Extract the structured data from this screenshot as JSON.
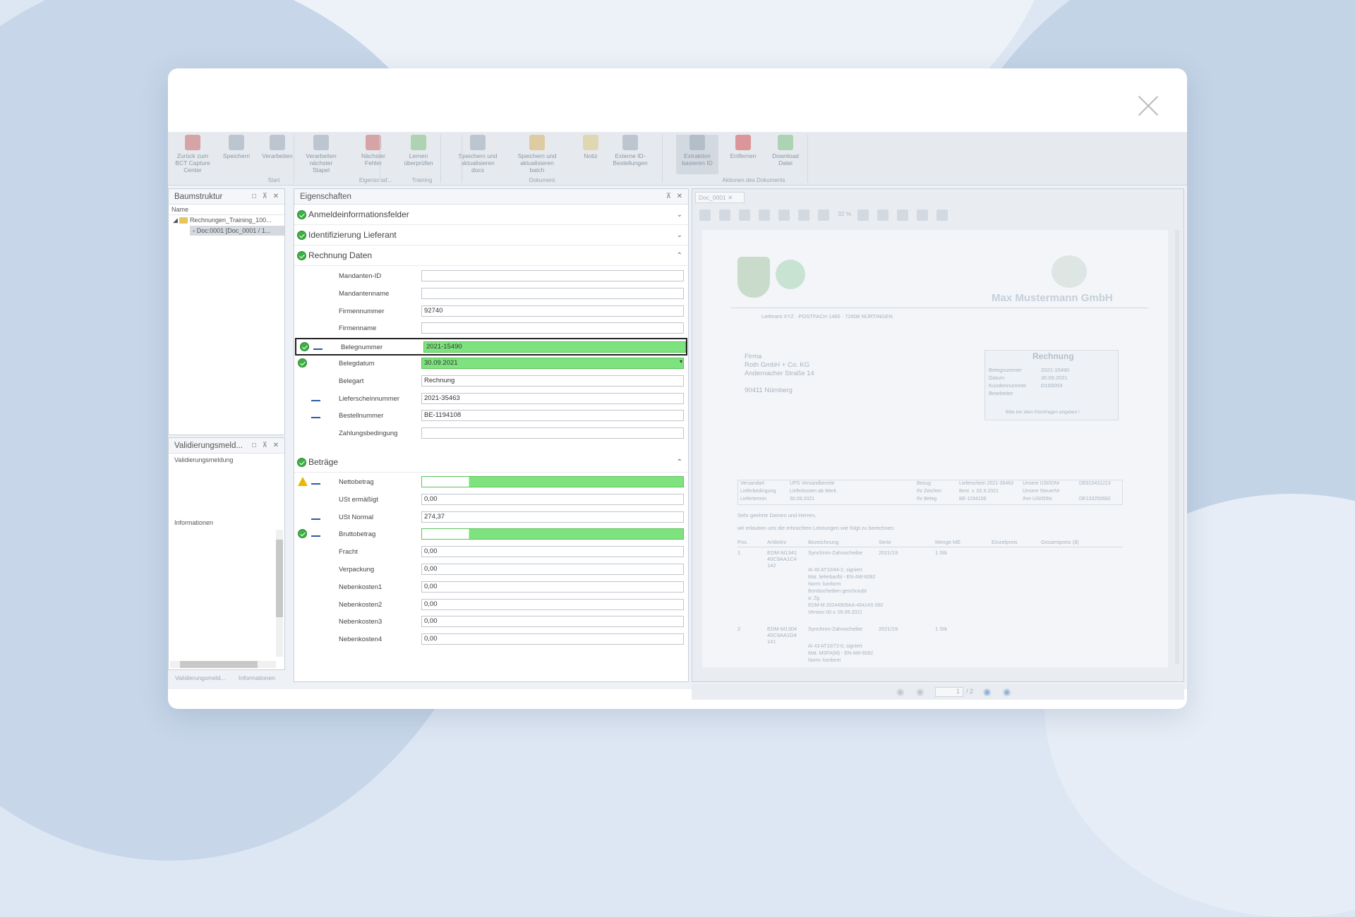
{
  "ribbon": {
    "buttons": [
      {
        "label": "Zurück zum BCT Capture Center",
        "icon": "back-icon",
        "color": "#c96a6a"
      },
      {
        "label": "Speichern",
        "icon": "save-icon",
        "color": "#9aa7b6"
      },
      {
        "label": "Verarbeiten",
        "icon": "process-icon",
        "color": "#9aa7b6"
      },
      {
        "label": "Verarbeiten nächster Stapel",
        "icon": "process-next-icon",
        "color": "#9aa7b6"
      },
      {
        "label": "Nächster Fehler",
        "icon": "next-error-icon",
        "color": "#c96a6a"
      },
      {
        "label": "Lernen überprüfen",
        "icon": "learn-icon",
        "color": "#7fbf7f"
      },
      {
        "label": "Speichern und aktualisieren docs",
        "icon": "save-update-docs-icon",
        "color": "#9aa7b6"
      },
      {
        "label": "Speichern und aktualisieren batch",
        "icon": "save-update-batch-icon",
        "color": "#d9b060"
      },
      {
        "label": "Notiz",
        "icon": "note-icon",
        "color": "#d9c480"
      },
      {
        "label": "Externe ID-Bestellungen",
        "icon": "external-id-icon",
        "color": "#9aa7b6"
      },
      {
        "label": "Extraktion basieren ID",
        "icon": "extraction-icon",
        "color": "#9aa7b6"
      },
      {
        "label": "Entfernen",
        "icon": "remove-icon",
        "color": "#d05050"
      },
      {
        "label": "Download Datei",
        "icon": "download-icon",
        "color": "#7fbf7f"
      }
    ],
    "groups": [
      "Start",
      "Eigenschaf...",
      "Training",
      "Dokument",
      "Aktionen des Dokuments"
    ]
  },
  "tree_panel": {
    "title": "Baumstruktur",
    "column": "Name",
    "items": [
      "Rechnungen_Training_100...",
      "Doc:0001 [Doc_0001 / 1..."
    ]
  },
  "validation_panel": {
    "title": "Validierungsmeld...",
    "header": "Validierungsmeldung",
    "info_header": "Informationen",
    "tabs": [
      "Validierungsmeld...",
      "Informationen"
    ]
  },
  "properties": {
    "title": "Eigenschaften",
    "sections": [
      "Anmeldeinformationsfelder",
      "Identifizierung Lieferant",
      "Rechnung Daten",
      "Beträge"
    ],
    "rechnung": [
      {
        "label": "Mandanten-ID",
        "value": ""
      },
      {
        "label": "Mandantenname",
        "value": ""
      },
      {
        "label": "Firmennummer",
        "value": "92740"
      },
      {
        "label": "Firmenname",
        "value": ""
      },
      {
        "label": "Belegnummer",
        "value": "2021-15490"
      },
      {
        "label": "Belegdatum",
        "value": "30.09.2021"
      },
      {
        "label": "Belegart",
        "value": "Rechnung"
      },
      {
        "label": "Lieferscheinnummer",
        "value": "2021-35463"
      },
      {
        "label": "Bestellnummer",
        "value": "BE-1194108"
      },
      {
        "label": "Zahlungsbedingung",
        "value": ""
      }
    ],
    "betraege": [
      {
        "label": "Nettobetrag",
        "value": ""
      },
      {
        "label": "USt ermäßigt",
        "value": "0,00"
      },
      {
        "label": "USt Normal",
        "value": "274,37"
      },
      {
        "label": "Bruttobetrag",
        "value": ""
      },
      {
        "label": "Fracht",
        "value": "0,00"
      },
      {
        "label": "Verpackung",
        "value": "0,00"
      },
      {
        "label": "Nebenkosten1",
        "value": "0,00"
      },
      {
        "label": "Nebenkosten2",
        "value": "0,00"
      },
      {
        "label": "Nebenkosten3",
        "value": "0,00"
      },
      {
        "label": "Nebenkosten4",
        "value": "0,00"
      }
    ]
  },
  "document": {
    "tab": "Doc_0001",
    "zoom": "32 %",
    "page_current": "1",
    "page_total": "/ 2",
    "company": "Max Mustermann GmbH",
    "sender_line": "Lieferant XYZ  ·  POSTFACH 1460 · 72608 NÜRTINGEN",
    "address": [
      "Firma",
      "Roth GmbH + Co. KG",
      "Andernacher Straße 14",
      "",
      "90411 Nürnberg"
    ],
    "invoice_box": {
      "title": "Rechnung",
      "rows": [
        [
          "Belegnummer",
          "2021-15490"
        ],
        [
          "Datum",
          "30.09.2021"
        ],
        [
          "Kundennummer",
          "D100003"
        ],
        [
          "Bearbeiter",
          ""
        ]
      ],
      "footer": "Bitte bei allen Rückfragen angeben !"
    },
    "meta": [
      [
        "Versandart",
        "UPS Versandbereite",
        "Bezug",
        "Lieferschein 2021-35463",
        "Unsere USt/IDNr",
        "DE815431213"
      ],
      [
        "Lieferbedingung",
        "Lieferkosten ab Werk",
        "Ihr Zeichen",
        "Best. v. 02.9.2021",
        "Unsere SteuerNr",
        ""
      ],
      [
        "Liefertermin",
        "30.09.2021",
        "Ihr Beleg",
        "BE-1194108",
        "Ihre USt/IDNr",
        "DE133250682"
      ]
    ],
    "greeting": "Sehr geehrte Damen und Herren,",
    "intro": "wir erlauben uns die erbrachten Leistungen wie folgt zu berechnen:",
    "table_headers": [
      "Pos.",
      "Artikelnr",
      "Bezeichnung",
      "Serie",
      "Menge ME",
      "Einzelpreis",
      "Gesamtpreis ($)"
    ],
    "lines": [
      [
        "1",
        "EDM-M1341 40C9AA1C4 142",
        "Synchron-Zahnscheibe",
        "2021/19",
        "1 Stk"
      ],
      [
        "2",
        "EDM-M1304 40C9AA1D4 141",
        "Synchron-Zahnscheibe",
        "2021/19",
        "1 Stk"
      ]
    ],
    "line_detail": [
      "AI 40 AT10/44-2, signiert",
      "Mat. lieferbar/bl - EN-AW-6082",
      "Norm: konform",
      "Bombscheiben geschraubt",
      "a: Zg",
      "EDM-M 20244909AA-40414S 060",
      "Version 00 v. 05.09.2021"
    ],
    "line_detail2": [
      "AI 43 AT10/72-0, signiert",
      "Mat. MSFA(M) - EN-AW-6082",
      "Norm: konform"
    ]
  }
}
